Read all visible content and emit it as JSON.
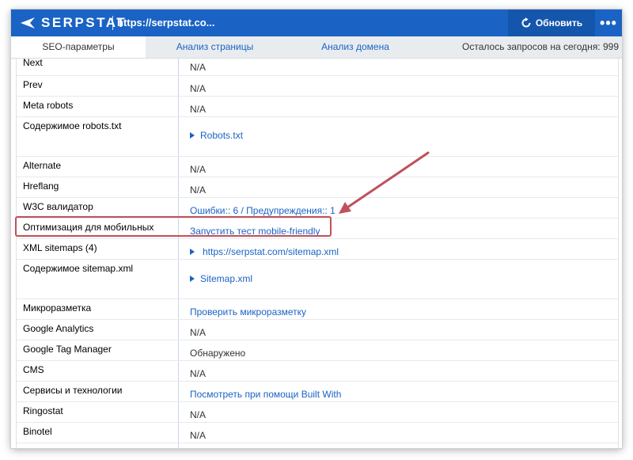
{
  "header": {
    "logo_text": "SERPSTAT",
    "url": "https://serpstat.co...",
    "refresh_label": "Обновить",
    "more_label": "•••"
  },
  "tabs": [
    {
      "label": "SEO-параметры",
      "active": true
    },
    {
      "label": "Анализ страницы",
      "active": false
    },
    {
      "label": "Анализ домена",
      "active": false
    }
  ],
  "quota": "Осталось запросов на сегодня: 999",
  "rows": [
    {
      "key": "Next",
      "value": "N/A",
      "type": "text"
    },
    {
      "key": "Prev",
      "value": "N/A",
      "type": "text"
    },
    {
      "key": "Meta robots",
      "value": "N/A",
      "type": "text"
    },
    {
      "key": "Содержимое robots.txt",
      "value": "Robots.txt",
      "type": "expand"
    },
    {
      "key": "Alternate",
      "value": "N/A",
      "type": "text"
    },
    {
      "key": "Hreflang",
      "value": "N/A",
      "type": "text"
    },
    {
      "key": "W3C валидатор",
      "value": "Ошибки:: 6 / Предупреждения:: 1",
      "type": "link"
    },
    {
      "key": "Оптимизация для мобильных",
      "value": "Запустить тест mobile-friendly",
      "type": "link"
    },
    {
      "key": "XML sitemaps (4)",
      "value": "https://serpstat.com/sitemap.xml",
      "type": "expand"
    },
    {
      "key": "Содержимое sitemap.xml",
      "value": "Sitemap.xml",
      "type": "expand"
    },
    {
      "key": "Микроразметка",
      "value": "Проверить микроразметку",
      "type": "link"
    },
    {
      "key": "Google Analytics",
      "value": "N/A",
      "type": "text"
    },
    {
      "key": "Google Tag Manager",
      "value": "Обнаружено",
      "type": "text"
    },
    {
      "key": "CMS",
      "value": "N/A",
      "type": "text"
    },
    {
      "key": "Сервисы и технологии",
      "value": "Посмотреть при помощи Built With",
      "type": "link"
    },
    {
      "key": "Ringostat",
      "value": "N/A",
      "type": "text"
    },
    {
      "key": "Binotel",
      "value": "N/A",
      "type": "text"
    }
  ],
  "colors": {
    "brand": "#1a63c4",
    "highlight": "#c0505a"
  }
}
